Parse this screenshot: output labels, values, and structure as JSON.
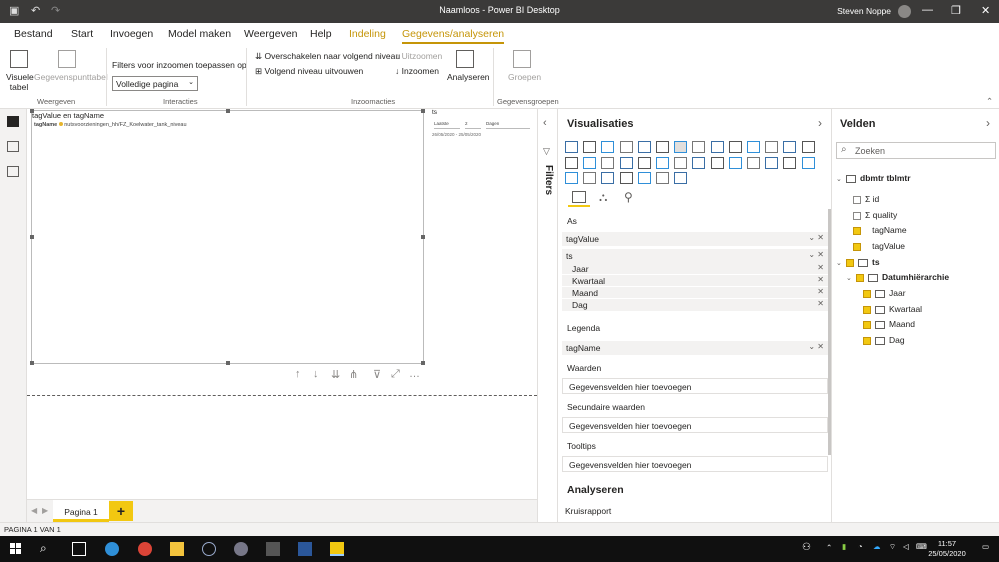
{
  "window": {
    "title": "Naamloos - Power BI Desktop",
    "user": "Steven Noppe"
  },
  "menu": {
    "tabs": [
      "Bestand",
      "Start",
      "Invoegen",
      "Model maken",
      "Weergeven",
      "Help",
      "Indeling",
      "Gegevens/analyseren"
    ]
  },
  "ribbon": {
    "visuele_tabel": "Visuele tabel",
    "gegevenspunttabel": "Gegevenspunttabel",
    "group_weergeven": "Weergeven",
    "filters_label": "Filters voor inzoomen toepassen op",
    "filters_select": "Volledige pagina",
    "group_interacties": "Interacties",
    "overschakelen": "Overschakelen naar volgend niveau",
    "volgend_niveau": "Volgend niveau uitvouwen",
    "uitzoomen": "Uitzoomen",
    "inzoomen": "Inzoomen",
    "analyseren": "Analyseren",
    "group_inzoomacties": "Inzoomacties",
    "groepen": "Groepen",
    "group_gegevensgroepen": "Gegevensgroepen"
  },
  "canvas": {
    "visual_title": "tagValue en tagName",
    "legend_label": "tagName",
    "legend_item": "nutsvoorzieningen_hh/FZ_Koelwater_tank_niveau",
    "slicer_title": "ts",
    "slicer_op": "Laatste",
    "slicer_n": "2",
    "slicer_unit": "Dagen",
    "slicer_range": "26/05/2020 - 25/05/2020"
  },
  "pages": {
    "tab": "Pagina 1",
    "add": "+"
  },
  "status": "PAGINA 1 VAN 1",
  "filters": "Filters",
  "viz": {
    "title": "Visualisaties",
    "as": "As",
    "as_fields": [
      "tagValue",
      "ts"
    ],
    "ts_levels": [
      "Jaar",
      "Kwartaal",
      "Maand",
      "Dag"
    ],
    "legenda": "Legenda",
    "legenda_field": "tagName",
    "waarden": "Waarden",
    "placeholder": "Gegevensvelden hier toevoegen",
    "secundaire": "Secundaire waarden",
    "tooltips": "Tooltips",
    "analyseren": "Analyseren",
    "kruisrapport": "Kruisrapport"
  },
  "fields": {
    "title": "Velden",
    "search_placeholder": "Zoeken",
    "table": "dbmtr tblmtr",
    "items": [
      "id",
      "quality",
      "tagName",
      "tagValue"
    ],
    "ts": "ts",
    "hierarchy": "Datumhiërarchie",
    "levels": [
      "Jaar",
      "Kwartaal",
      "Maand",
      "Dag"
    ]
  },
  "taskbar": {
    "time": "11:57",
    "date": "25/05/2020"
  },
  "colors": {
    "accent": "#f2c811",
    "titlebar": "#3b3a39"
  }
}
